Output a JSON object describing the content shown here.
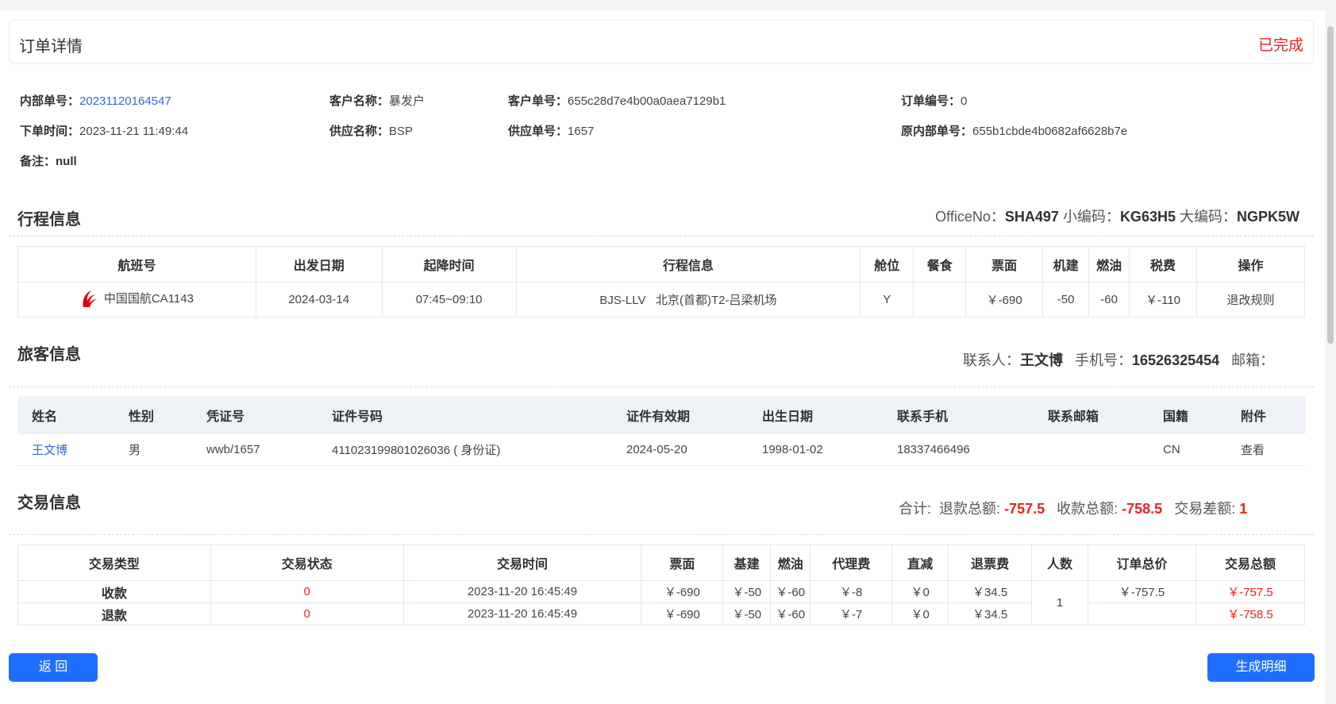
{
  "header": {
    "title": "订单详情",
    "status": "已完成"
  },
  "order_info": {
    "internal_no_label": "内部单号：",
    "internal_no": "20231120164547",
    "customer_name_label": "客户名称：",
    "customer_name": "暴发户",
    "customer_no_label": "客户单号：",
    "customer_no": "655c28d7e4b00a0aea7129b1",
    "order_no_label": "订单编号：",
    "order_no": "0",
    "order_time_label": "下单时间：",
    "order_time": "2023-11-21 11:49:44",
    "supplier_name_label": "供应名称：",
    "supplier_name": "BSP",
    "supplier_no_label": "供应单号：",
    "supplier_no": "1657",
    "orig_internal_no_label": "原内部单号：",
    "orig_internal_no": "655b1cbde4b0682af6628b7e",
    "remark_label": "备注：",
    "remark": "null"
  },
  "itinerary": {
    "title": "行程信息",
    "office_label": "OfficeNo：",
    "office": "SHA497",
    "small_code_label": "小编码：",
    "small_code": "KG63H5",
    "big_code_label": "大编码：",
    "big_code": "NGPK5W",
    "columns": [
      "航班号",
      "出发日期",
      "起降时间",
      "行程信息",
      "舱位",
      "餐食",
      "票面",
      "机建",
      "燃油",
      "税费",
      "操作"
    ],
    "row": {
      "flight": "中国国航CA1143",
      "date": "2024-03-14",
      "time": "07:45~09:10",
      "route": "BJS-LLV   北京(首都)T2-吕梁机场",
      "cabin": "Y",
      "meal": "",
      "fare": "￥-690",
      "airport_fee": "-50",
      "fuel": "-60",
      "tax": "￥-110",
      "action": "退改规则"
    },
    "airline_color": "#e60012"
  },
  "passenger": {
    "title": "旅客信息",
    "contact_label": "联系人：",
    "contact": "王文博",
    "phone_label": "手机号：",
    "phone": "16526325454",
    "email_label": "邮箱：",
    "email": "",
    "columns": [
      "姓名",
      "性别",
      "凭证号",
      "证件号码",
      "证件有效期",
      "出生日期",
      "联系手机",
      "联系邮箱",
      "国籍",
      "附件"
    ],
    "row": {
      "name": "王文博",
      "gender": "男",
      "voucher": "wwb/1657",
      "id_no": "411023199801026036 ( 身份证)",
      "id_valid": "2024-05-20",
      "birth": "1998-01-02",
      "mobile": "18337466496",
      "email": "",
      "nationality": "CN",
      "attachment": "查看"
    }
  },
  "trade": {
    "title": "交易信息",
    "sum_label": "合计:",
    "refund_total_label": "退款总额:",
    "refund_total": "-757.5",
    "receipt_total_label": "收款总额:",
    "receipt_total": "-758.5",
    "diff_label": "交易差额:",
    "diff": "1",
    "columns": [
      "交易类型",
      "交易状态",
      "交易时间",
      "票面",
      "基建",
      "燃油",
      "代理费",
      "直减",
      "退票费",
      "人数",
      "订单总价",
      "交易总额"
    ],
    "rows": [
      {
        "type": "收款",
        "status": "0",
        "time": "2023-11-20 16:45:49",
        "fare": "￥-690",
        "airport_fee": "￥-50",
        "fuel": "￥-60",
        "agent_fee": "￥-8",
        "discount": "￥0",
        "refund_fee": "￥34.5",
        "order_total": "￥-757.5",
        "trade_total": "￥-757.5"
      },
      {
        "type": "退款",
        "status": "0",
        "time": "2023-11-20 16:45:49",
        "fare": "￥-690",
        "airport_fee": "￥-50",
        "fuel": "￥-60",
        "agent_fee": "￥-7",
        "discount": "￥0",
        "refund_fee": "￥34.5",
        "order_total": "",
        "trade_total": "￥-758.5"
      }
    ],
    "people": "1"
  },
  "buttons": {
    "back": "返 回",
    "generate": "生成明细"
  },
  "colors": {
    "primary": "#1e6fff",
    "danger": "#f0201d",
    "link": "#2f6bd9"
  }
}
